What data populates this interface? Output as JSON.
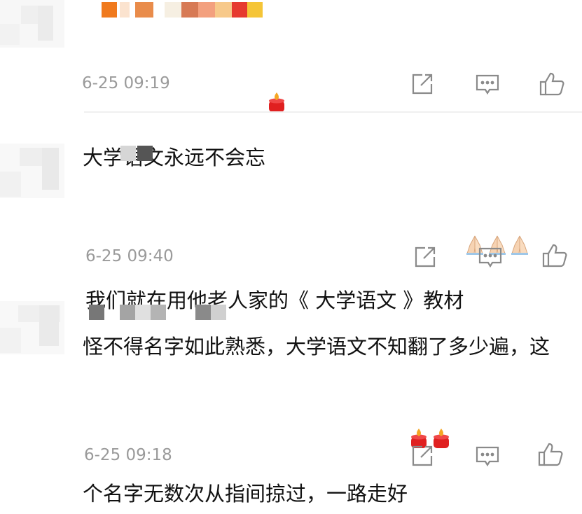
{
  "comments": [
    {
      "text": "大学语文永远不会忘",
      "emojis": [
        "candle"
      ],
      "time": "6-25 09:19"
    },
    {
      "text": "我们就在用他老人家的《 大学语文 》教材",
      "emojis": [
        "folded-hands",
        "folded-hands",
        "folded-hands"
      ],
      "time": "6-25 09:40"
    },
    {
      "text": "怪不得名字如此熟悉，大学语文不知翻了多少遍，这个名字无数次从指间掠过，一路走好",
      "emojis": [
        "candle",
        "candle"
      ],
      "time": "6-25 09:18"
    }
  ],
  "actions": [
    "share-icon",
    "reply-icon",
    "like-icon"
  ],
  "colors": {
    "meta_text": "#9a9a9a",
    "icon_stroke": "#8a8a8a",
    "candle": "#e02020"
  }
}
